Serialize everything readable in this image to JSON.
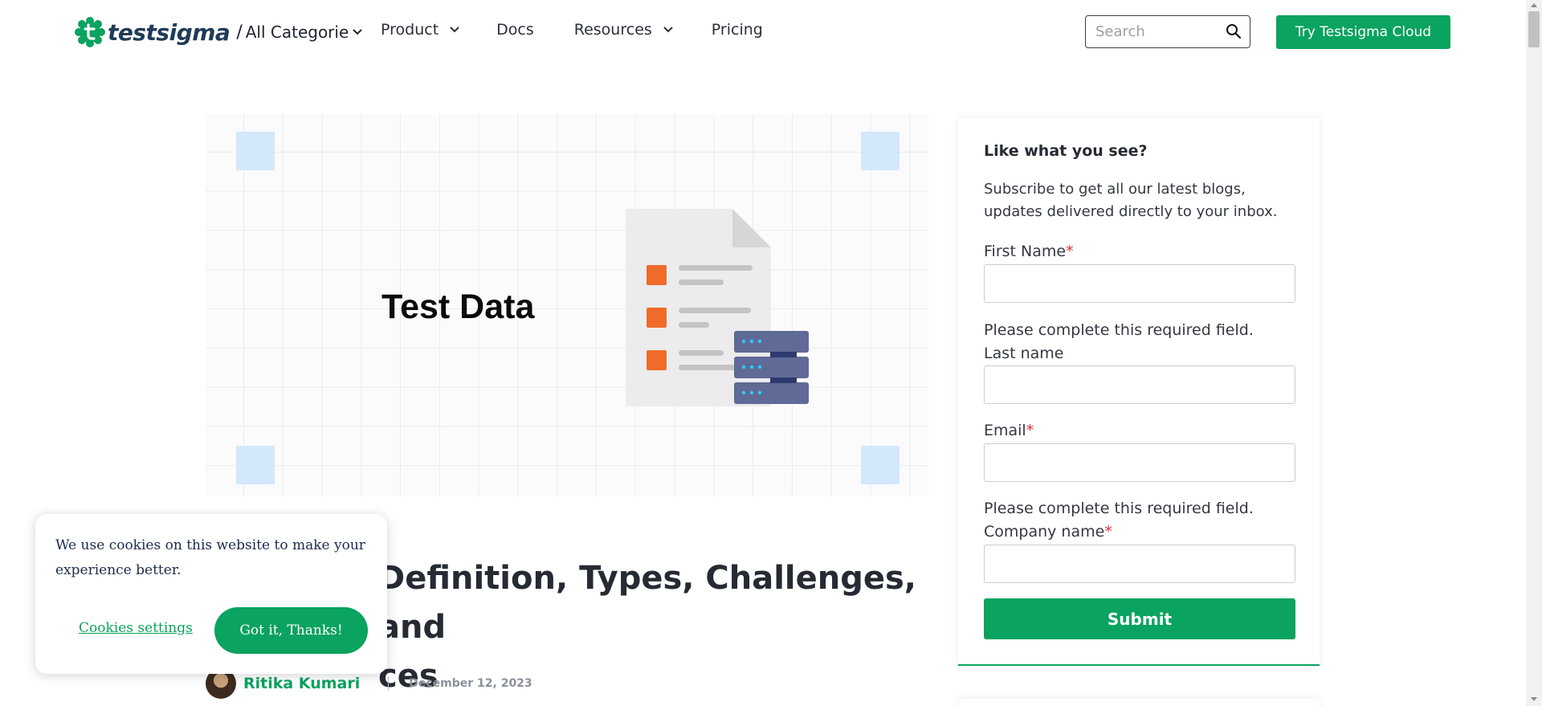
{
  "header": {
    "logo_text": "testsigma",
    "separator": "/",
    "category_dropdown": "All Categorie",
    "nav": [
      {
        "label": "Product",
        "has_dropdown": true
      },
      {
        "label": "Docs",
        "has_dropdown": false
      },
      {
        "label": "Resources",
        "has_dropdown": true
      },
      {
        "label": "Pricing",
        "has_dropdown": false
      }
    ],
    "search_placeholder": "Search",
    "cta_label": "Try Testsigma Cloud"
  },
  "hero": {
    "title": "Test Data"
  },
  "article": {
    "title": "Test Data: Definition, Types, Challenges, and Best Practices",
    "title_visible_line1": "Definition, Types, Challenges, and",
    "title_visible_line2": "ces",
    "author": "Ritika Kumari",
    "date": "December 12, 2023"
  },
  "cookie_banner": {
    "message": "We use cookies on this website to make your experience better.",
    "settings_label": "Cookies settings",
    "accept_label": "Got it, Thanks!"
  },
  "subscribe_form": {
    "heading": "Like what you see?",
    "subtext": "Subscribe to get all our latest blogs, updates delivered directly to your inbox.",
    "first_name_label": "First Name",
    "required_marker": "*",
    "error_message": "Please complete this required field.",
    "last_name_label": "Last name",
    "email_label": "Email",
    "company_label": "Company name",
    "submit_label": "Submit"
  },
  "colors": {
    "brand_green": "#0aa35f",
    "required_red": "#e0343a",
    "hero_highlight": "#d4e8fc",
    "illus_orange": "#f06b2a",
    "server_blue": "#5f6b96"
  },
  "icons": [
    "testsigma-logo-icon",
    "chevron-down-icon",
    "search-icon",
    "document-icon",
    "server-icon"
  ]
}
